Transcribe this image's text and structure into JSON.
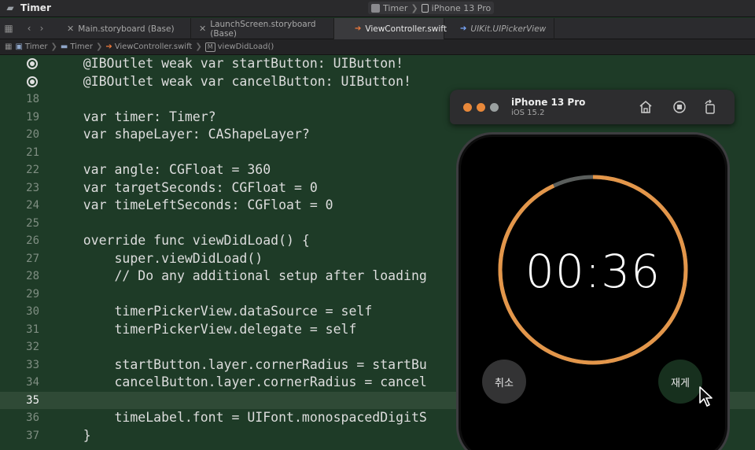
{
  "titlebar": {
    "app_title": "Timer",
    "scheme_project": "Timer",
    "scheme_device": "iPhone 13 Pro"
  },
  "tabs": [
    {
      "label": "Main.storyboard (Base)",
      "kind": "storyboard"
    },
    {
      "label": "LaunchScreen.storyboard (Base)",
      "kind": "storyboard"
    },
    {
      "label": "ViewController.swift",
      "kind": "swift",
      "active": true
    },
    {
      "label": "UIKit.UIPickerView",
      "kind": "uikit"
    }
  ],
  "jumpbar": {
    "crumbs": [
      "Timer",
      "Timer",
      "ViewController.swift",
      "viewDidLoad()"
    ],
    "method_badge": "M"
  },
  "editor": {
    "current_line": "35",
    "lines": [
      {
        "num": "",
        "text": "    @IBOutlet weak var startButton: UIButton!",
        "breakpoint": true
      },
      {
        "num": "",
        "text": "    @IBOutlet weak var cancelButton: UIButton!",
        "breakpoint": true
      },
      {
        "num": "18",
        "text": ""
      },
      {
        "num": "19",
        "text": "    var timer: Timer?"
      },
      {
        "num": "20",
        "text": "    var shapeLayer: CAShapeLayer?"
      },
      {
        "num": "21",
        "text": ""
      },
      {
        "num": "22",
        "text": "    var angle: CGFloat = 360"
      },
      {
        "num": "23",
        "text": "    var targetSeconds: CGFloat = 0"
      },
      {
        "num": "24",
        "text": "    var timeLeftSeconds: CGFloat = 0"
      },
      {
        "num": "25",
        "text": ""
      },
      {
        "num": "26",
        "text": "    override func viewDidLoad() {"
      },
      {
        "num": "27",
        "text": "        super.viewDidLoad()"
      },
      {
        "num": "28",
        "text": "        // Do any additional setup after loading"
      },
      {
        "num": "29",
        "text": ""
      },
      {
        "num": "30",
        "text": "        timerPickerView.dataSource = self"
      },
      {
        "num": "31",
        "text": "        timerPickerView.delegate = self"
      },
      {
        "num": "32",
        "text": ""
      },
      {
        "num": "33",
        "text": "        startButton.layer.cornerRadius = startBu"
      },
      {
        "num": "34",
        "text": "        cancelButton.layer.cornerRadius = cancel"
      },
      {
        "num": "35",
        "text": ""
      },
      {
        "num": "36",
        "text": "        timeLabel.font = UIFont.monospacedDigitS                  main)"
      },
      {
        "num": "37",
        "text": "    }"
      }
    ]
  },
  "simulator": {
    "device_name": "iPhone 13 Pro",
    "os_version": "iOS 15.2",
    "traffic_colors": [
      "#e8883a",
      "#e8883a",
      "#9aa0a0"
    ],
    "home_icon": "home-icon",
    "screenshot_icon": "stop-circle-icon",
    "rotate_icon": "rotate-icon"
  },
  "app": {
    "time_label": "00:36",
    "cancel_label": "취소",
    "resume_label": "재게",
    "ring_color": "#e3964a",
    "ring_remaining_fraction": 0.93,
    "ring_track_color": "#5a5e5c"
  }
}
